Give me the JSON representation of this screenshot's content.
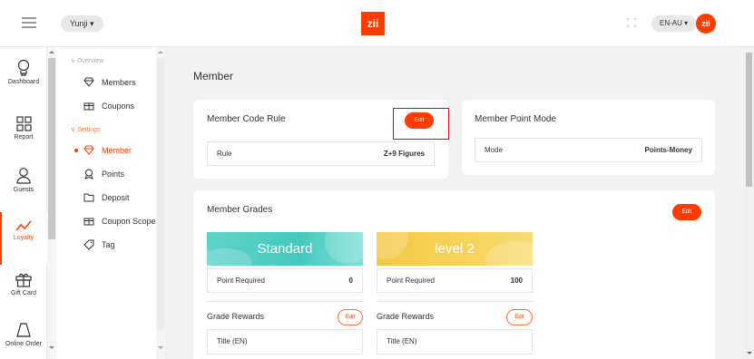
{
  "header": {
    "user_name": "Yunji",
    "logo_text": "zii",
    "language": "EN-AU",
    "avatar_text": "zii"
  },
  "rail": {
    "items": [
      {
        "label": "Dashboard",
        "icon": "dashboard-icon"
      },
      {
        "label": "Report",
        "icon": "report-grid-icon"
      },
      {
        "label": "Guests",
        "icon": "user-icon"
      },
      {
        "label": "Loyalty",
        "icon": "trend-line-icon",
        "active": true
      },
      {
        "label": "Gift Card",
        "icon": "gift-icon"
      },
      {
        "label": "Online Order",
        "icon": "order-icon"
      }
    ]
  },
  "submenu": {
    "sections": {
      "overview": "Overview",
      "settings": "Settings"
    },
    "items": [
      {
        "label": "Members",
        "icon": "diamond-icon"
      },
      {
        "label": "Coupons",
        "icon": "gift-box-icon"
      },
      {
        "label": "Member",
        "icon": "diamond-icon",
        "active": true
      },
      {
        "label": "Points",
        "icon": "award-icon"
      },
      {
        "label": "Deposit",
        "icon": "folder-icon"
      },
      {
        "label": "Coupon Scope",
        "icon": "gift-box-icon"
      },
      {
        "label": "Tag",
        "icon": "tag-icon"
      }
    ]
  },
  "main": {
    "page_title": "Member",
    "code_rule": {
      "title": "Member Code Rule",
      "edit_label": "Edit",
      "field_label": "Rule",
      "field_value": "Z+9 Figures"
    },
    "point_mode": {
      "title": "Member Point Mode",
      "field_label": "Mode",
      "field_value": "Points-Money"
    },
    "grades": {
      "title": "Member Grades",
      "edit_label": "Edit",
      "items": [
        {
          "name": "Standard",
          "point_label": "Point Required",
          "points": "0",
          "rewards_title": "Grade Rewards",
          "rewards_edit": "Edit",
          "col_title": "Title (EN)"
        },
        {
          "name": "level 2",
          "point_label": "Point Required",
          "points": "100",
          "rewards_title": "Grade Rewards",
          "rewards_edit": "Edit",
          "col_title": "Title (EN)"
        }
      ]
    }
  },
  "colors": {
    "accent": "#ff3b00",
    "standard_banner": "#45c9bd",
    "level2_banner": "#f7d35a"
  }
}
